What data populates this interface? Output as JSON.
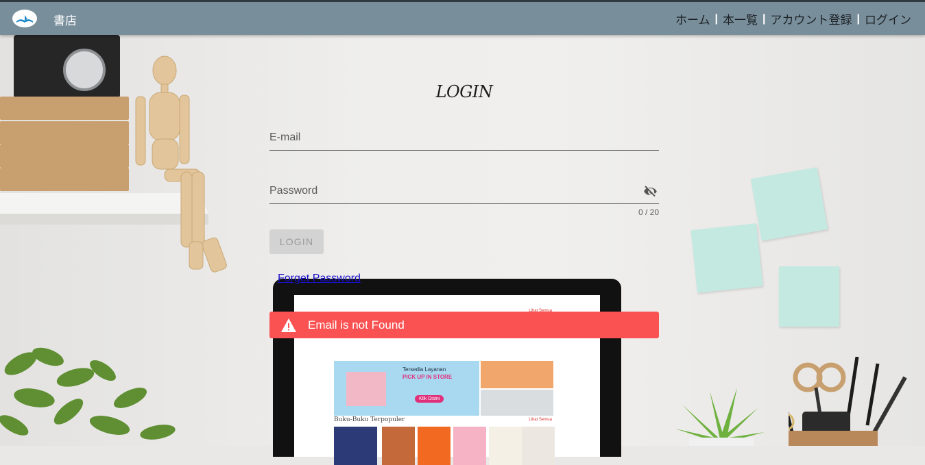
{
  "header": {
    "brand": "書店",
    "nav": [
      {
        "label": "ホーム"
      },
      {
        "label": "本一覧"
      },
      {
        "label": "アカウント登録"
      },
      {
        "label": "ログイン"
      }
    ]
  },
  "login": {
    "title": "LOGIN",
    "email_placeholder": "E-mail",
    "password_placeholder": "Password",
    "password_counter": "0 / 20",
    "submit_label": "LOGIN",
    "forget_label": "Forget Password"
  },
  "alert": {
    "message": "Email is not Found",
    "color": "#fa5253"
  },
  "background_laptop": {
    "book_section_title": "Buku-Buku Terpopuler",
    "see_all": "Lihat Semua",
    "banner_line1": "Tersedia Layanan",
    "banner_line2": "PICK UP IN STORE",
    "banner_button": "Klik Disini"
  },
  "colors": {
    "header": "#788e9b",
    "alert": "#fa5253",
    "link": "#1a10c8"
  }
}
